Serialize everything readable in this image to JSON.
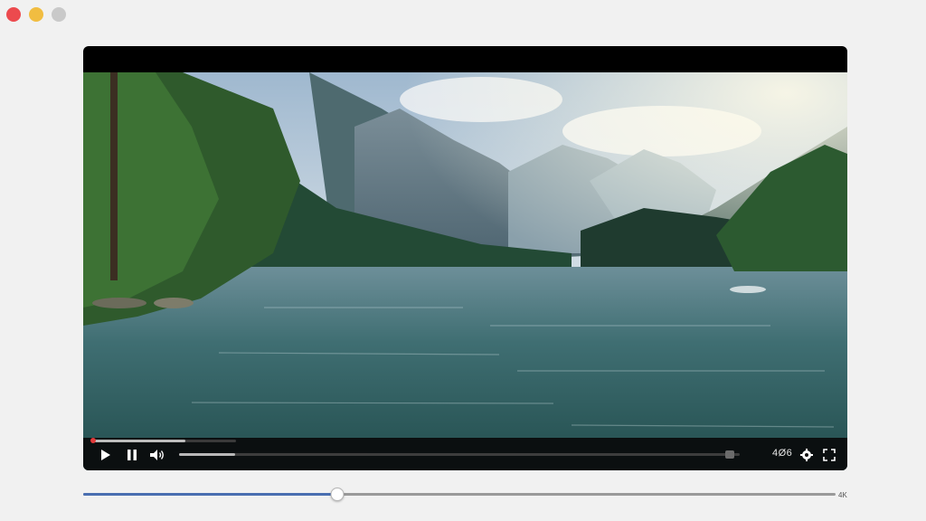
{
  "window": {
    "controls": [
      "close",
      "minimize",
      "zoom"
    ]
  },
  "player": {
    "chapter_progress": 0.65,
    "playback_progress": 0.1,
    "buffer_thumb_position": 0.99,
    "quality_label": "4Ø6",
    "buttons": {
      "play_icon": "play-icon",
      "pause_icon": "pause-icon",
      "volume_icon": "volume-icon",
      "settings_icon": "gear-icon",
      "fullscreen_icon": "fullscreen-icon"
    }
  },
  "seek_bar": {
    "progress": 0.338,
    "end_label": "4K"
  },
  "colors": {
    "accent_blue": "#4a6fb1",
    "record_red": "#e23a3a",
    "window_bg": "#f1f1f1"
  }
}
